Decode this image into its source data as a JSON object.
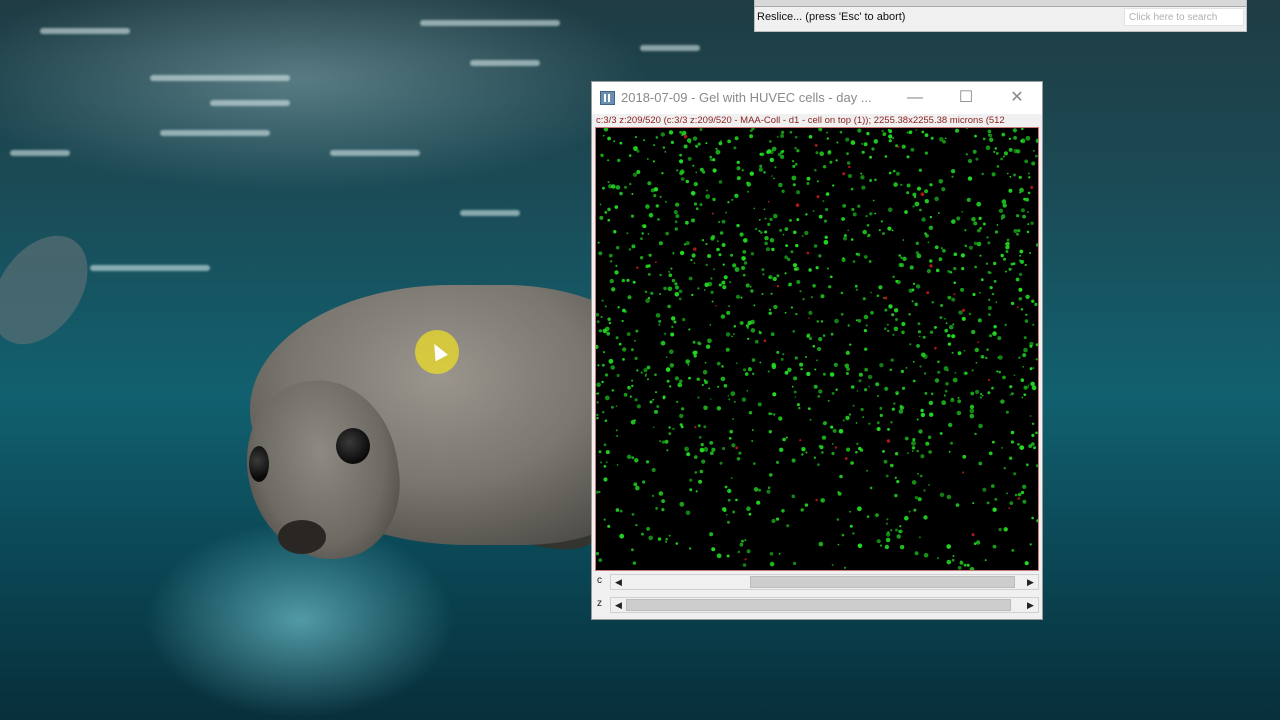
{
  "imagej": {
    "status_text": "Reslice... (press 'Esc' to abort)",
    "search_placeholder": "Click here to search"
  },
  "image_window": {
    "title": "2018-07-09 - Gel with HUVEC cells - day ...",
    "minimize_glyph": "—",
    "maximize_glyph": "☐",
    "close_glyph": "✕",
    "info_line": "c:3/3 z:209/520 (c:3/3 z:209/520 - MAA-Coll - d1 - cell on top (1)); 2255.38x2255.38 microns (512",
    "sliders": [
      {
        "label": "c",
        "left_arrow": "◀",
        "right_arrow": "▶",
        "position": 0.31
      },
      {
        "label": "z",
        "left_arrow": "◀",
        "right_arrow": "▶",
        "position": 0.0
      }
    ]
  },
  "colors": {
    "cell_green": "#22dd22",
    "cell_red": "#b01818",
    "info_text": "#8b1e1e",
    "cursor_halo": "#ebdc28"
  }
}
